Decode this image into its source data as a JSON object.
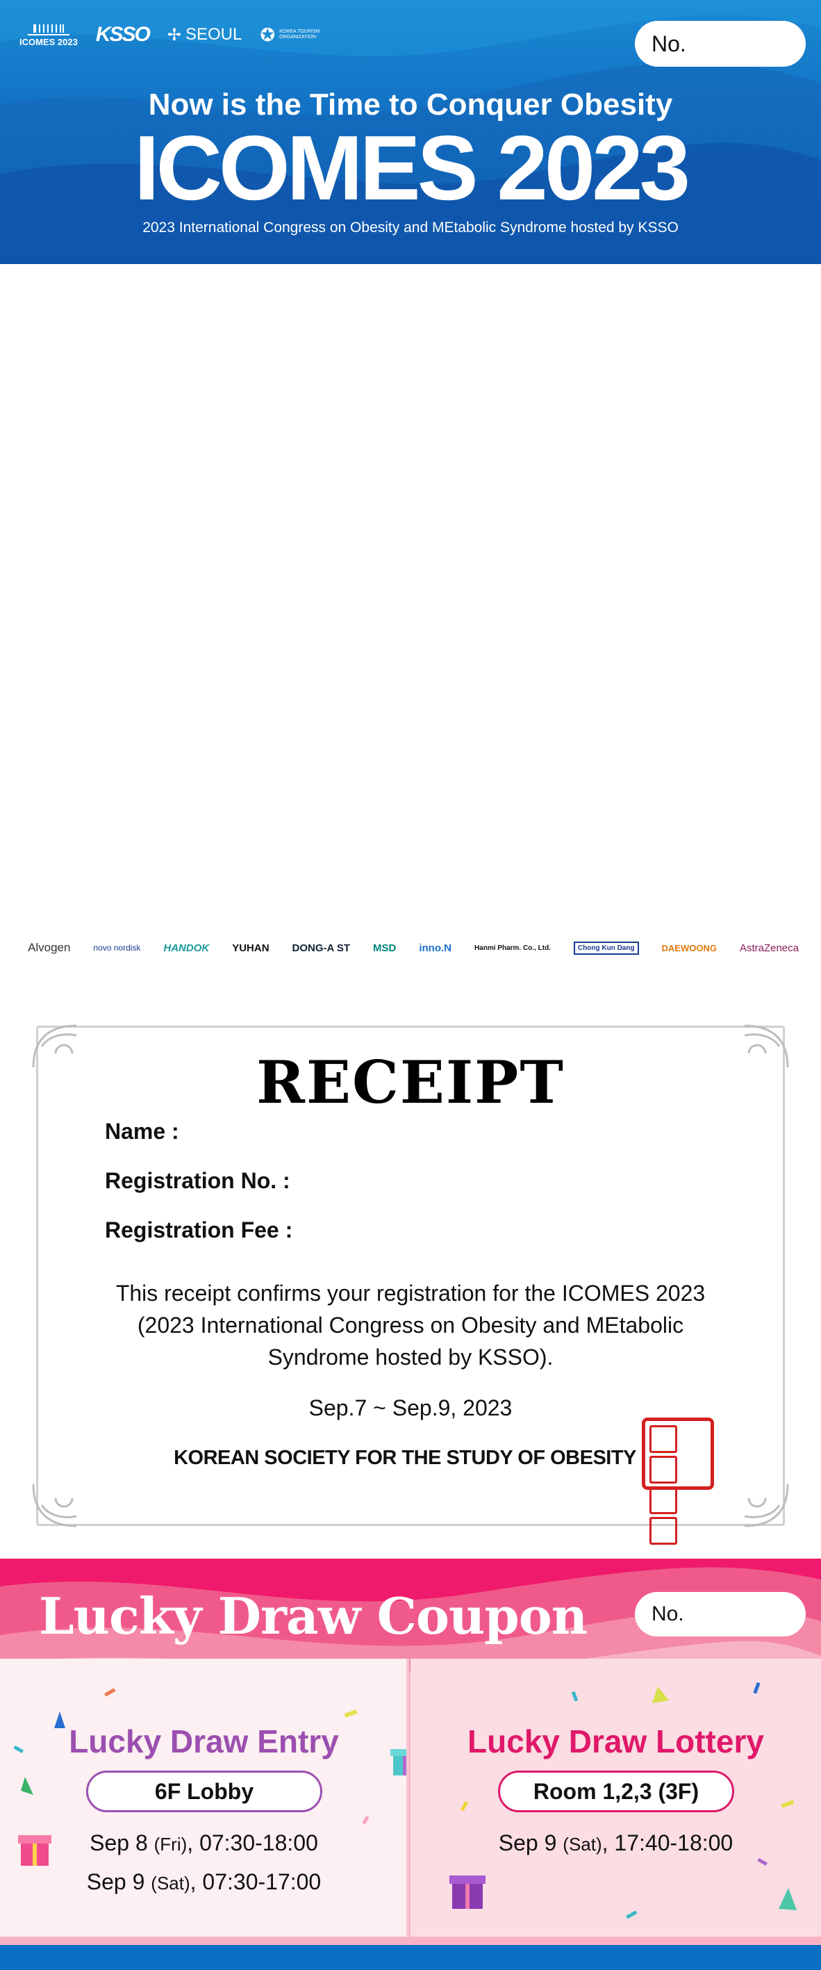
{
  "header": {
    "logos": {
      "icomes": "ICOMES 2023",
      "ksso": "KSSO",
      "seoul": "SEOUL",
      "kto": "KOREA TOURISM ORGANIZATION"
    },
    "no_label": "No.",
    "tagline": "Now is the Time to Conquer Obesity",
    "title": "ICOMES 2023",
    "subtitle": "2023 International Congress on Obesity and MEtabolic Syndrome hosted by KSSO"
  },
  "sponsors": [
    "Alvogen",
    "novo nordisk",
    "HANDOK",
    "YUHAN",
    "DONG-A ST",
    "MSD",
    "inno.N",
    "Hanmi Pharm. Co., Ltd.",
    "Chong Kun Dang",
    "DAEWOONG",
    "AstraZeneca"
  ],
  "receipt": {
    "title": "RECEIPT",
    "name_label": "Name :",
    "registration_no_label": "Registration No. :",
    "registration_fee_label": "Registration Fee :",
    "confirmation": "This receipt confirms your registration for the ICOMES 2023 (2023 International Congress on Obesity and MEtabolic Syndrome hosted by KSSO).",
    "dates": "Sep.7 ~ Sep.9, 2023",
    "society": "KOREAN SOCIETY FOR THE STUDY OF OBESITY"
  },
  "lucky_draw": {
    "title": "Lucky Draw Coupon",
    "no_label": "No.",
    "entry": {
      "title": "Lucky Draw Entry",
      "location": "6F Lobby",
      "time1_date": "Sep 8",
      "time1_day": "(Fri)",
      "time1_hours": ", 07:30-18:00",
      "time2_date": "Sep 9",
      "time2_day": "(Sat)",
      "time2_hours": ", 07:30-17:00"
    },
    "lottery": {
      "title": "Lucky Draw Lottery",
      "location": "Room 1,2,3 (3F)",
      "time1_date": "Sep 9",
      "time1_day": "(Sat)",
      "time1_hours": ", 17:40-18:00"
    }
  },
  "colors": {
    "header_blue": "#1270c2",
    "lucky_pink": "#f4517e",
    "entry_purple": "#9b4fb0",
    "lottery_magenta": "#e0186a",
    "seal_red": "#d42020"
  }
}
